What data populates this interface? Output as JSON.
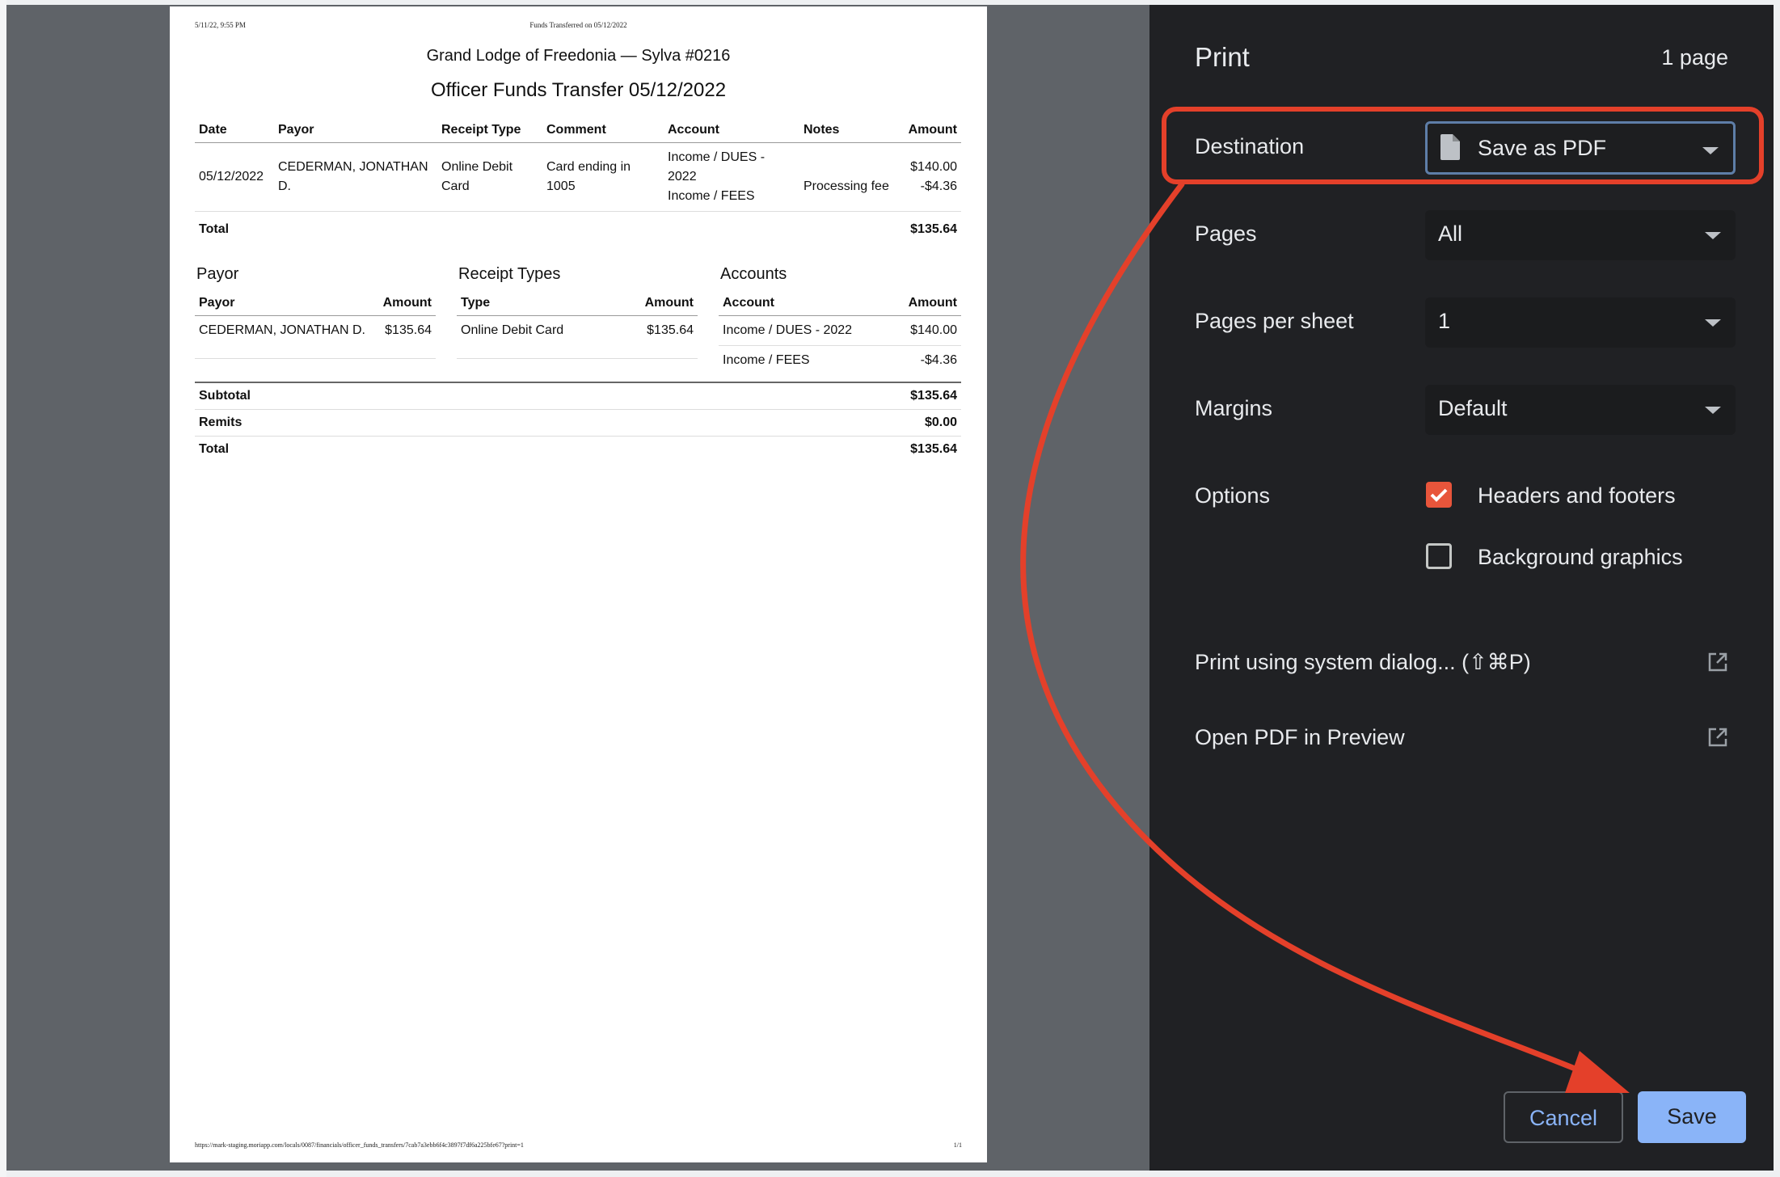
{
  "preview": {
    "header_date": "5/11/22, 9:55 PM",
    "header_title": "Funds Transferred on 05/12/2022",
    "lodge": "Grand Lodge of Freedonia — Sylva #0216",
    "report_title": "Officer Funds Transfer 05/12/2022",
    "main_table": {
      "headers": [
        "Date",
        "Payor",
        "Receipt Type",
        "Comment",
        "Account",
        "Notes",
        "Amount"
      ],
      "row": {
        "date": "05/12/2022",
        "payor": "CEDERMAN, JONATHAN D.",
        "receipt_type": "Online Debit Card",
        "comment": "Card ending in 1005",
        "account_1": "Income / DUES - 2022",
        "account_2": "Income / FEES",
        "notes": "Processing fee",
        "amount_1": "$140.00",
        "amount_2": "-$4.36"
      },
      "total_label": "Total",
      "total_value": "$135.64"
    },
    "payor_section": {
      "title": "Payor",
      "headers": [
        "Payor",
        "Amount"
      ],
      "rows": [
        {
          "name": "CEDERMAN, JONATHAN D.",
          "amount": "$135.64"
        }
      ]
    },
    "receipt_section": {
      "title": "Receipt Types",
      "headers": [
        "Type",
        "Amount"
      ],
      "rows": [
        {
          "name": "Online Debit Card",
          "amount": "$135.64"
        }
      ]
    },
    "accounts_section": {
      "title": "Accounts",
      "headers": [
        "Account",
        "Amount"
      ],
      "rows": [
        {
          "name": "Income / DUES - 2022",
          "amount": "$140.00"
        },
        {
          "name": "Income / FEES",
          "amount": "-$4.36"
        }
      ]
    },
    "summary": [
      {
        "label": "Subtotal",
        "value": "$135.64"
      },
      {
        "label": "Remits",
        "value": "$0.00"
      },
      {
        "label": "Total",
        "value": "$135.64"
      }
    ],
    "footer_url": "https://mark-staging.moriapp.com/locals/0087/financials/officer_funds_transfers/7cab7a3ebb6f4c3897f7df6a225bfe67?print=1",
    "footer_page": "1/1"
  },
  "print_panel": {
    "title": "Print",
    "page_count": "1 page",
    "destination": {
      "label": "Destination",
      "value": "Save as PDF",
      "icon": "file-icon"
    },
    "pages": {
      "label": "Pages",
      "value": "All"
    },
    "pages_per_sheet": {
      "label": "Pages per sheet",
      "value": "1"
    },
    "margins": {
      "label": "Margins",
      "value": "Default"
    },
    "options": {
      "label": "Options",
      "headers_footers": {
        "label": "Headers and footers",
        "checked": true
      },
      "background_graphics": {
        "label": "Background graphics",
        "checked": false
      }
    },
    "system_dialog": "Print using system dialog... (⇧⌘P)",
    "open_pdf": "Open PDF in Preview",
    "cancel_label": "Cancel",
    "save_label": "Save"
  },
  "colors": {
    "annotation": "#e4402a",
    "accent": "#8ab4f8",
    "checkbox_on": "#e8553b",
    "panel_bg": "#202124"
  }
}
